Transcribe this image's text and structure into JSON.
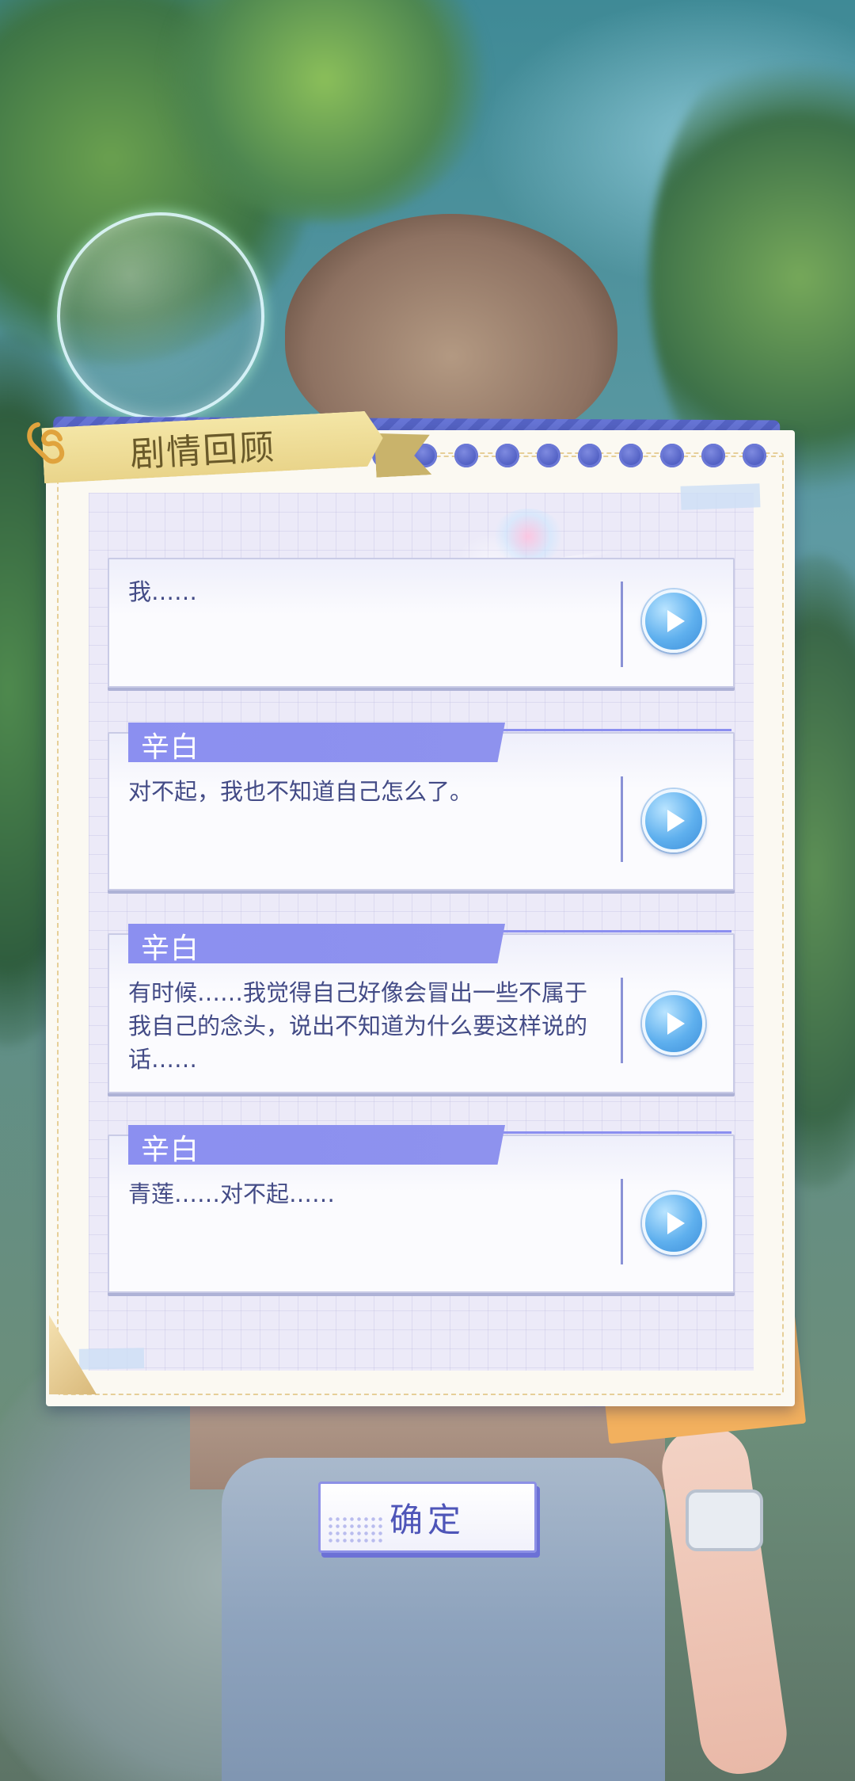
{
  "panel": {
    "title": "剧情回顾"
  },
  "entries": [
    {
      "speaker": "",
      "text": "我……"
    },
    {
      "speaker": "辛白",
      "text": "对不起，我也不知道自己怎么了。"
    },
    {
      "speaker": "辛白",
      "text": "有时候……我觉得自己好像会冒出一些不属于我自己的念头，说出不知道为什么要这样说的话……"
    },
    {
      "speaker": "辛白",
      "text": "青莲……对不起……"
    }
  ],
  "confirm": {
    "label": "确定"
  },
  "icons": {
    "play": "play-icon",
    "clip": "paperclip-icon"
  },
  "colors": {
    "accent": "#8b8ff0",
    "play": "#5fb0ee",
    "ribbon": "#f4e6a6",
    "text": "#434b86"
  }
}
